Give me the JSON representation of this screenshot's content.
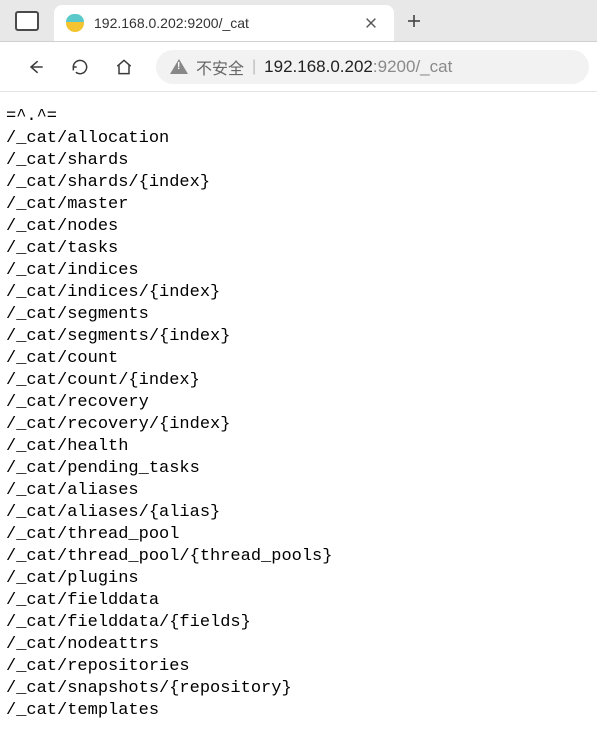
{
  "tab": {
    "title": "192.168.0.202:9200/_cat"
  },
  "address": {
    "not_secure_label": "不安全",
    "host": "192.168.0.202",
    "port": ":9200",
    "path": "/_cat"
  },
  "body": {
    "header_art": "=^.^=",
    "endpoints": [
      "/_cat/allocation",
      "/_cat/shards",
      "/_cat/shards/{index}",
      "/_cat/master",
      "/_cat/nodes",
      "/_cat/tasks",
      "/_cat/indices",
      "/_cat/indices/{index}",
      "/_cat/segments",
      "/_cat/segments/{index}",
      "/_cat/count",
      "/_cat/count/{index}",
      "/_cat/recovery",
      "/_cat/recovery/{index}",
      "/_cat/health",
      "/_cat/pending_tasks",
      "/_cat/aliases",
      "/_cat/aliases/{alias}",
      "/_cat/thread_pool",
      "/_cat/thread_pool/{thread_pools}",
      "/_cat/plugins",
      "/_cat/fielddata",
      "/_cat/fielddata/{fields}",
      "/_cat/nodeattrs",
      "/_cat/repositories",
      "/_cat/snapshots/{repository}",
      "/_cat/templates"
    ]
  }
}
